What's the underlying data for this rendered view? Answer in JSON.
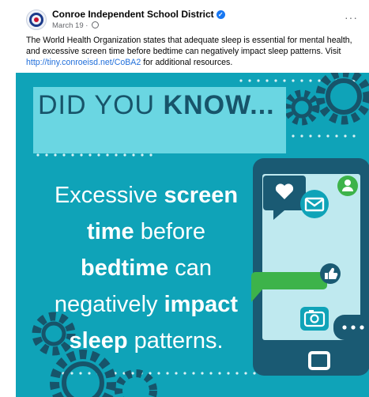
{
  "post": {
    "author": "Conroe Independent School District",
    "date": "March 19 · ",
    "caption_text": "The World Health Organization states that adequate sleep is essential for mental health, and excessive screen time before bedtime can negatively impact sleep patterns. Visit ",
    "caption_link": "http://tiny.conroeisd.net/CoBA2",
    "caption_after": " for additional resources.",
    "more_label": "···"
  },
  "graphic": {
    "heading_plain": "DID YOU ",
    "heading_bold": "KNOW...",
    "line1_plain": "Excessive ",
    "line1_bold": "screen",
    "line2_bold": "time",
    "line2_plain": " before",
    "line3_bold": "bedtime",
    "line3_plain": " can",
    "line4_plain": "negatively ",
    "line4_bold": "impact",
    "line5_bold": "sleep",
    "line5_plain": " patterns."
  },
  "icons": [
    "verified-badge-icon",
    "globe-icon",
    "heart-icon",
    "mail-icon",
    "user-icon",
    "thumbs-up-icon",
    "camera-icon",
    "chat-dots-icon",
    "gear-icon"
  ],
  "colors": {
    "background": "#0fa3b8",
    "banner": "#6ad6e2",
    "heading": "#17546a",
    "phone": "#1a5a73",
    "link": "#216fdb"
  }
}
